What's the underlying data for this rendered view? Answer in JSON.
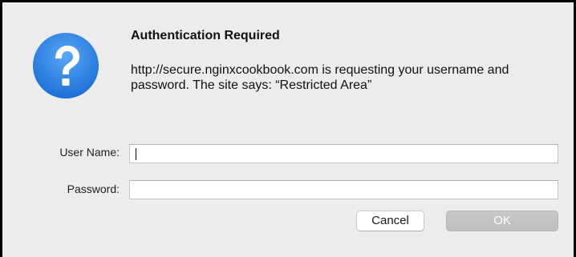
{
  "dialog": {
    "title": "Authentication Required",
    "message": "http://secure.nginxcookbook.com is requesting your username and password. The site says: “Restricted Area”",
    "icon": "question-mark-icon",
    "icon_color": "#2f7fe0"
  },
  "form": {
    "username_label": "User Name:",
    "username_value": "",
    "password_label": "Password:",
    "password_value": ""
  },
  "buttons": {
    "cancel_label": "Cancel",
    "ok_label": "OK"
  }
}
